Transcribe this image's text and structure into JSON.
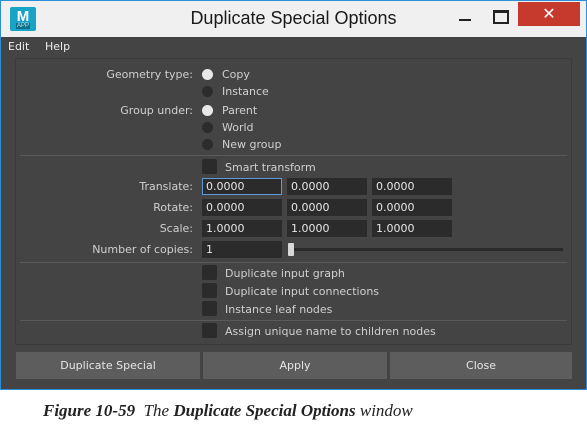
{
  "window": {
    "title": "Duplicate Special Options",
    "icon_letter": "M",
    "icon_sub": "APP",
    "close_glyph": "✕"
  },
  "menu": [
    "Edit",
    "Help"
  ],
  "geometry_type": {
    "label": "Geometry type:",
    "options": [
      "Copy",
      "Instance"
    ],
    "selected": "Copy"
  },
  "group_under": {
    "label": "Group under:",
    "options": [
      "Parent",
      "World",
      "New group"
    ],
    "selected": "Parent"
  },
  "smart_transform": {
    "label": "Smart transform",
    "checked": false
  },
  "translate": {
    "label": "Translate:",
    "values": [
      "0.0000",
      "0.0000",
      "0.0000"
    ]
  },
  "rotate": {
    "label": "Rotate:",
    "values": [
      "0.0000",
      "0.0000",
      "0.0000"
    ]
  },
  "scale": {
    "label": "Scale:",
    "values": [
      "1.0000",
      "1.0000",
      "1.0000"
    ]
  },
  "copies": {
    "label": "Number of copies:",
    "value": "1"
  },
  "checkboxes": [
    {
      "label": "Duplicate input graph",
      "checked": false
    },
    {
      "label": "Duplicate input connections",
      "checked": false
    },
    {
      "label": "Instance leaf nodes",
      "checked": false
    },
    {
      "label": "Assign unique name to children nodes",
      "checked": false
    }
  ],
  "buttons": [
    "Duplicate Special",
    "Apply",
    "Close"
  ],
  "caption": {
    "figure": "Figure 10-59",
    "pre": "The",
    "bold": "Duplicate Special Options",
    "post": "window"
  }
}
